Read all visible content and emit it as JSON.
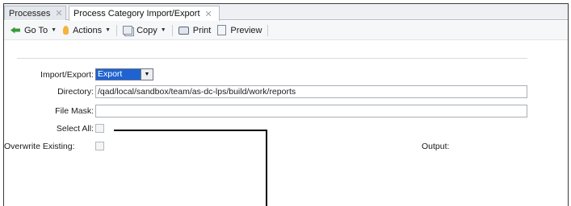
{
  "tabs": [
    {
      "label": "Processes",
      "close": "✕"
    },
    {
      "label": "Process Category Import/Export",
      "close": "✕"
    }
  ],
  "toolbar": {
    "goto_label": "Go To",
    "actions_label": "Actions",
    "copy_label": "Copy",
    "print_label": "Print",
    "preview_label": "Preview"
  },
  "form": {
    "import_export_label": "Import/Export:",
    "import_export_value": "Export",
    "directory_label": "Directory:",
    "directory_value": "/qad/local/sandbox/team/as-dc-lps/build/work/reports",
    "file_mask_label": "File Mask:",
    "file_mask_value": "",
    "select_all_label": "Select All:",
    "overwrite_label": "Overwrite Existing:",
    "output_label": "Output:"
  },
  "icons": {
    "goto": "green-arrow-icon",
    "actions": "lightbulb-icon",
    "copy": "copy-icon",
    "print": "printer-icon",
    "preview": "preview-icon"
  }
}
